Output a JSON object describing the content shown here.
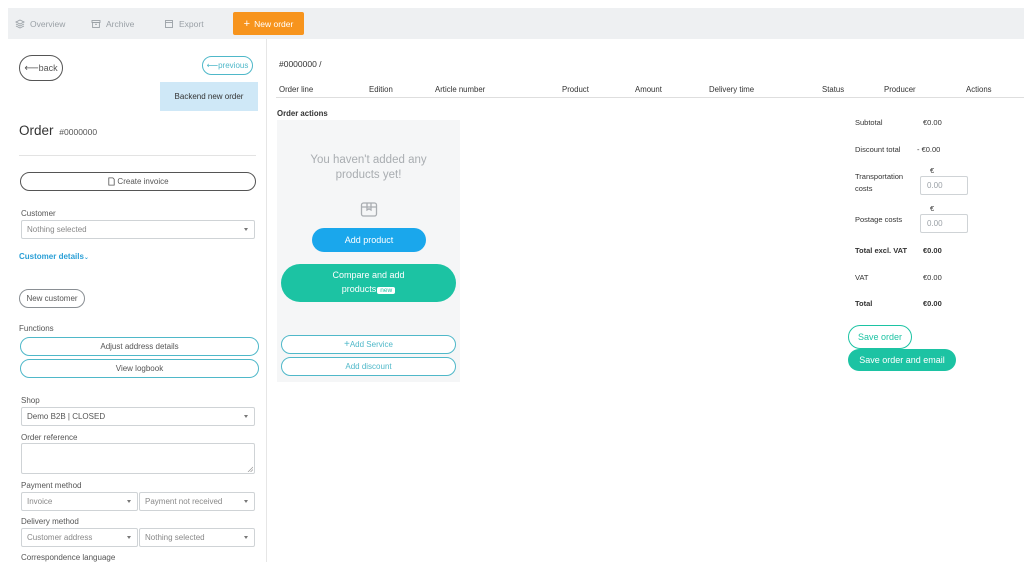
{
  "topnav": {
    "overview": "Overview",
    "archive": "Archive",
    "export": "Export",
    "new_order": "New order"
  },
  "left": {
    "back": "back",
    "previous": "previous",
    "backend_new_order": "Backend new order",
    "order_title": "Order",
    "order_number": "#0000000",
    "create_invoice": "Create invoice",
    "customer_label": "Customer",
    "customer_value": "Nothing selected",
    "customer_details": "Customer details",
    "new_customer": "New customer",
    "functions_label": "Functions",
    "adjust_address": "Adjust address details",
    "view_logbook": "View logbook",
    "shop_label": "Shop",
    "shop_value": "Demo B2B | CLOSED",
    "order_reference_label": "Order reference",
    "payment_method_label": "Payment method",
    "payment_method_value": "Invoice",
    "payment_status_value": "Payment not received",
    "delivery_method_label": "Delivery method",
    "delivery_method_value": "Customer address",
    "delivery_option_value": "Nothing selected",
    "correspondence_label": "Correspondence language"
  },
  "main": {
    "breadcrumb": "#0000000 /",
    "columns": [
      "Order line",
      "Edition",
      "Article number",
      "Product",
      "Amount",
      "Delivery time",
      "Status",
      "Producer",
      "Actions"
    ],
    "order_actions": "Order actions",
    "empty_line1": "You haven't added any",
    "empty_line2": "products yet!",
    "add_product": "Add product",
    "compare_line1": "Compare and add",
    "compare_line2": "products",
    "new_badge": "new",
    "add_service": "Add Service",
    "add_discount": "Add discount"
  },
  "summary": {
    "subtotal_label": "Subtotal",
    "subtotal_value": "€0.00",
    "discount_label": "Discount total",
    "discount_value": "- €0.00",
    "transport_label1": "Transportation",
    "transport_label2": "costs",
    "transport_currency": "€",
    "transport_placeholder": "0.00",
    "postage_label": "Postage costs",
    "postage_currency": "€",
    "postage_placeholder": "0.00",
    "total_excl_label": "Total excl. VAT",
    "total_excl_value": "€0.00",
    "vat_label": "VAT",
    "vat_value": "€0.00",
    "total_label": "Total",
    "total_value": "€0.00",
    "save_order": "Save order",
    "save_order_email": "Save order and email"
  },
  "colors": {
    "accent_orange": "#f7941d",
    "teal": "#1cc3a3",
    "blue": "#1aa7ec",
    "outline_teal": "#4fb8c9",
    "link_blue": "#2a9fd6"
  }
}
